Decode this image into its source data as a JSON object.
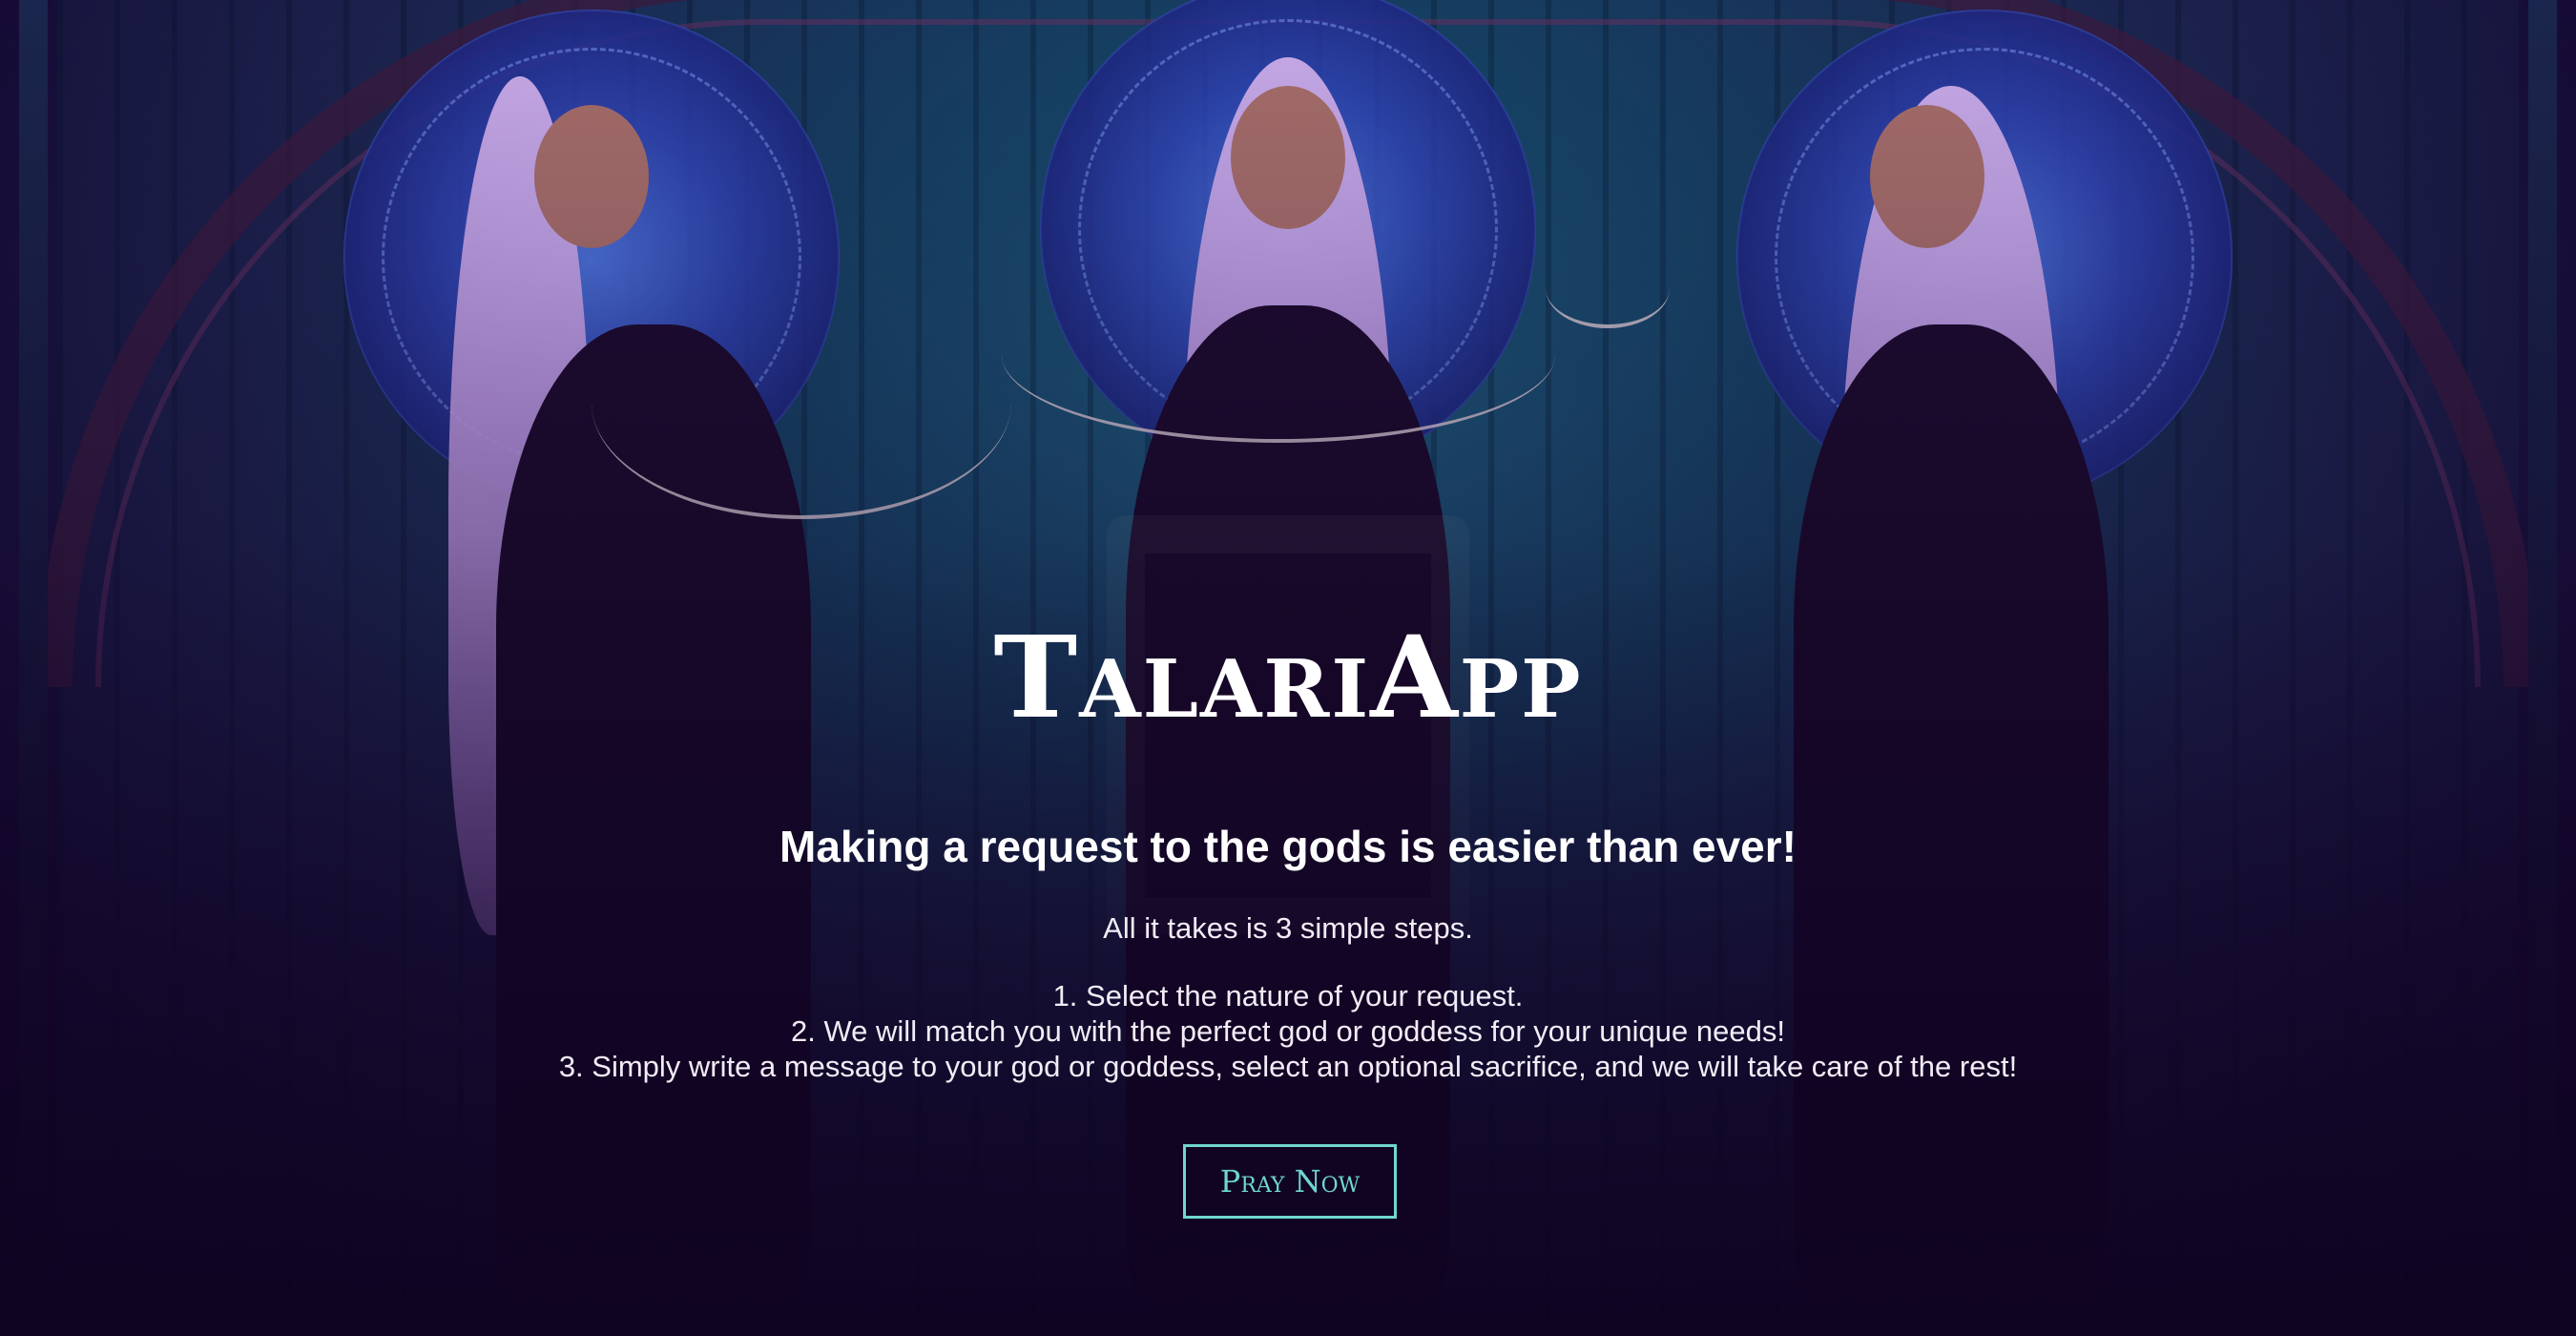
{
  "hero": {
    "title": "TalariApp",
    "subtitle": "Making a request to the gods is easier than ever!",
    "lead": "All it takes is 3 simple steps.",
    "steps": [
      "1. Select the nature of your request.",
      "2. We will match you with the perfect god or goddess for your unique needs!",
      "3. Simply write a message to your god or goddess, select an optional sacrifice, and we will take care of the rest!"
    ],
    "cta_label": "Pray Now"
  },
  "colors": {
    "accent": "#6fd7cf",
    "background": "#12052a",
    "text": "#ffffff"
  }
}
